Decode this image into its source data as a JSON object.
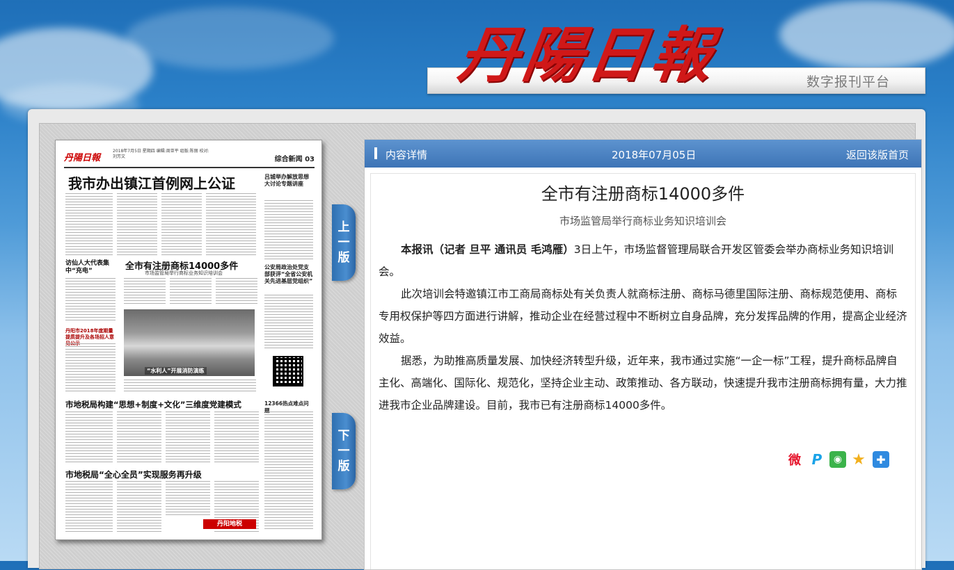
{
  "masthead": {
    "logo_text": "丹陽日報",
    "platform_title": "数字报刊平台"
  },
  "paper": {
    "logo": "丹陽日報",
    "meta": "2018年7月5日 星期四 编辑:周亚平 组版:陈丽 校对:刘芳文",
    "section": "综合新闻 03",
    "headline_main": "我市办出镇江首例网上公证",
    "headline_side1": "吕城举办解放思想大讨论专题讲座",
    "headline_left1": "访仙人大代表集中“充电”",
    "headline_center": "全市有注册商标14000多件",
    "subhead_center": "市场监管局举行商标业务知识培训会",
    "headline_side2": "公安局政治处党支部获评“全省公安机关先进基层党组织”",
    "box_left": "丹阳市2018年度期量提质提升及各场招人意见公示",
    "photo_caption": "“水利人”开展消防演练",
    "headline_tax1": "市地税局构建“思想+制度+文化”三维度党建模式",
    "side_hotline": "12366热点难点问题",
    "headline_tax2": "市地税局“全心全员”实现服务再升级",
    "ad_label": "丹阳地税"
  },
  "nav": {
    "prev_label": [
      "上",
      "一",
      "版"
    ],
    "next_label": [
      "下",
      "一",
      "版"
    ]
  },
  "content_bar": {
    "label": "内容详情",
    "date": "2018年07月05日",
    "back_link": "返回该版首页"
  },
  "article": {
    "title": "全市有注册商标14000多件",
    "subtitle": "市场监管局举行商标业务知识培训会",
    "byline": "本报讯（记者  旦平  通讯员  毛鸿雁）",
    "para1_rest": "3日上午，市场监督管理局联合开发区管委会举办商标业务知识培训会。",
    "para2": "此次培训会特邀镇江市工商局商标处有关负责人就商标注册、商标马德里国际注册、商标规范使用、商标专用权保护等四方面进行讲解，推动企业在经营过程中不断树立自身品牌，充分发挥品牌的作用，提高企业经济效益。",
    "para3": "据悉，为助推高质量发展、加快经济转型升级，近年来，我市通过实施“一企一标”工程，提升商标品牌自主化、高端化、国际化、规范化，坚持企业主动、政策推动、各方联动，快速提升我市注册商标拥有量，大力推进我市企业品牌建设。目前，我市已有注册商标14000多件。"
  },
  "share": {
    "weibo_color": "#e6162d",
    "weibo_glyph": "微",
    "tqq_color": "#1aa3e8",
    "tqq_glyph": "P",
    "wechat_color": "#3bb34a",
    "wechat_glyph": "◉",
    "qzone_color": "#f2b01e",
    "qzone_glyph": "★",
    "more_color": "#2f8ae0",
    "more_glyph": "✚"
  }
}
